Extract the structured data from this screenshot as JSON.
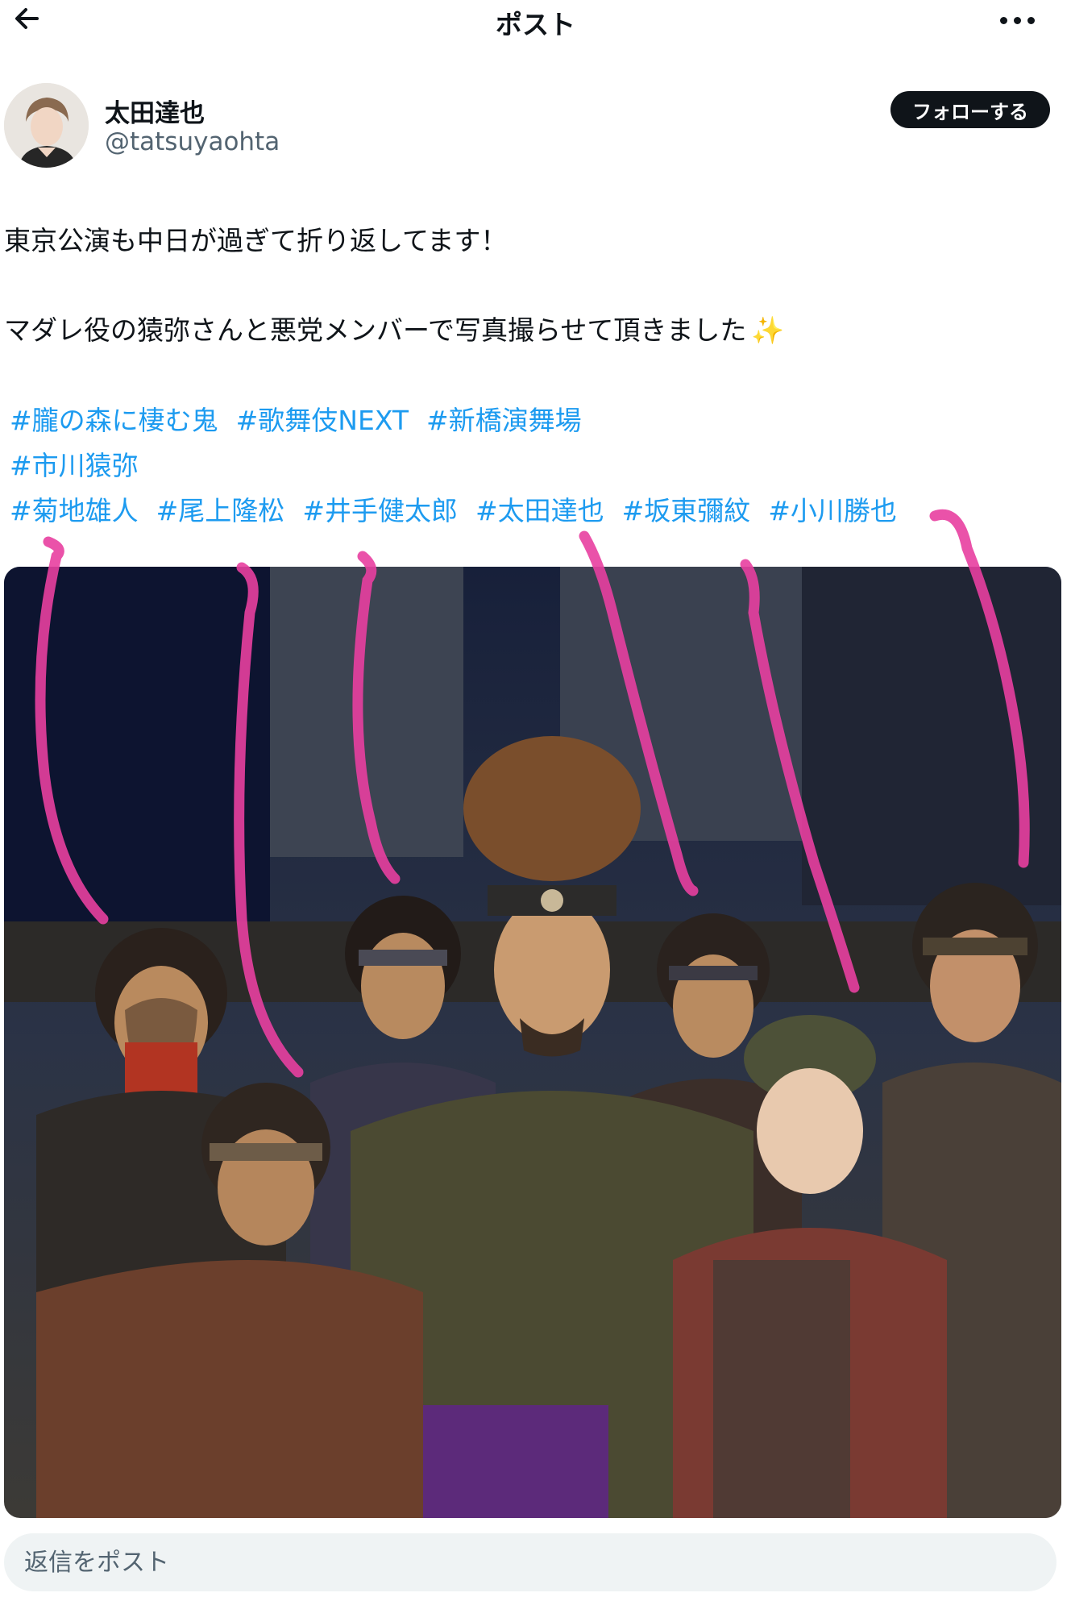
{
  "header": {
    "back_icon": "arrow-left-icon",
    "title": "ポスト",
    "more_icon": "more-horizontal-icon"
  },
  "author": {
    "name": "太田達也",
    "handle": "@tatsuyaohta",
    "follow_label": "フォローする"
  },
  "post": {
    "line1": "東京公演も中日が過ぎて折り返してます！",
    "line2": "マダレ役の猿弥さんと悪党メンバーで写真撮らせて頂きました",
    "sparkle": "✨",
    "hashtags_row1": [
      "#朧の森に棲む鬼",
      "#歌舞伎NEXT",
      "#新橋演舞場"
    ],
    "hashtags_row2": [
      "#市川猿弥"
    ],
    "hashtags_row3": [
      "#菊地雄人",
      "#尾上隆松",
      "#井手健太郎",
      "#太田達也",
      "#坂東彌紋",
      "#小川勝也"
    ]
  },
  "colors": {
    "link": "#1d9bf0",
    "annotation": "#e83fa0",
    "follow_bg": "#0f1419"
  },
  "reply": {
    "placeholder": "返信をポスト"
  }
}
